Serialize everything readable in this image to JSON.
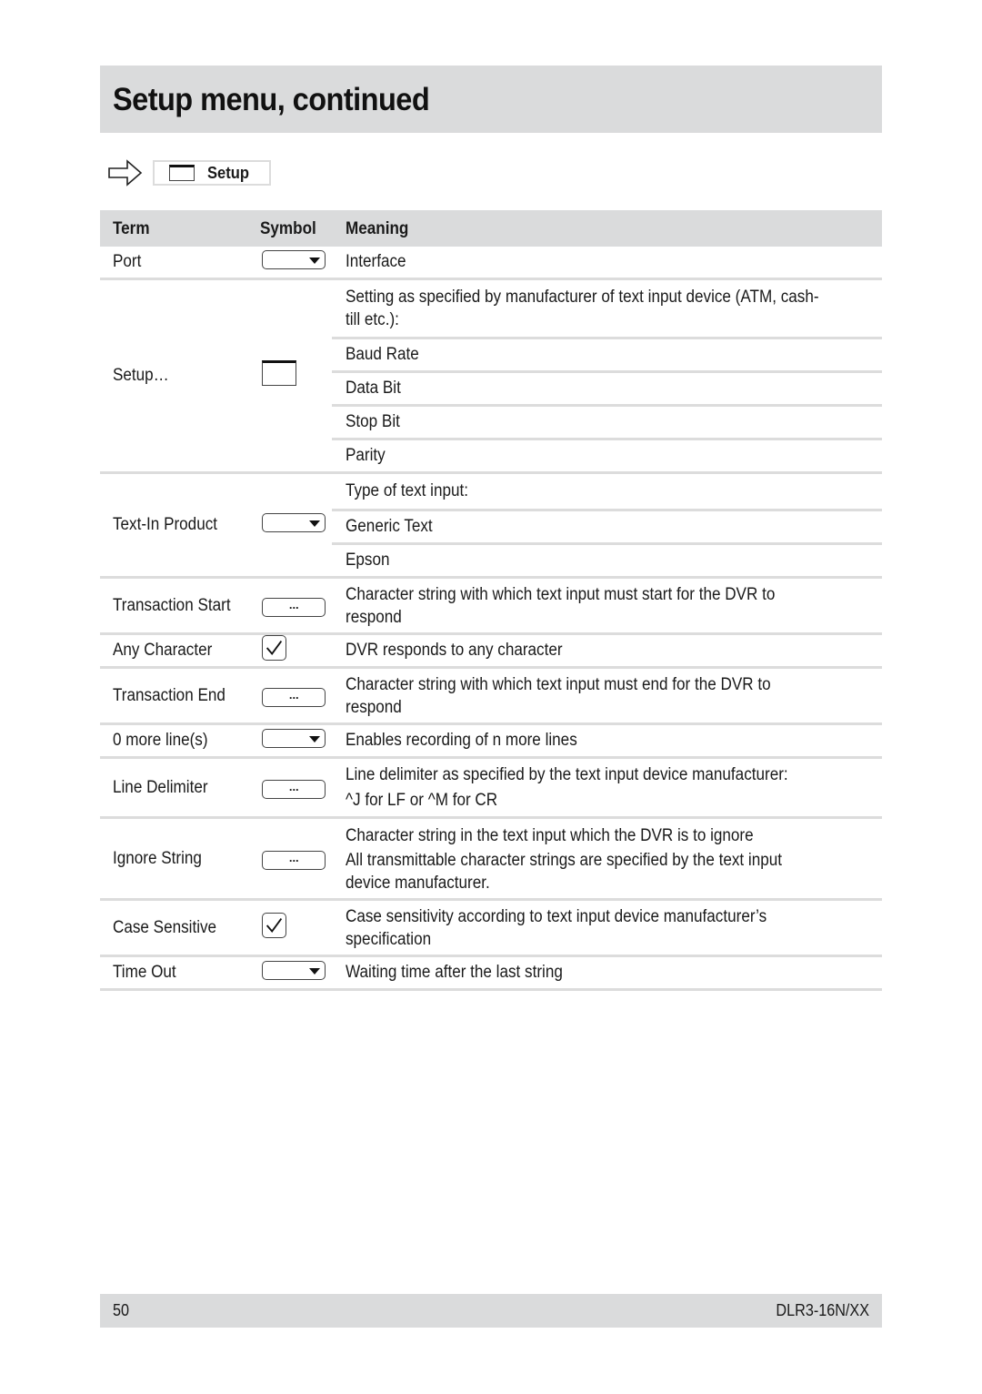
{
  "page": {
    "title": "Setup menu, continued",
    "breadcrumb": {
      "icon": "window-icon",
      "label": "Setup"
    }
  },
  "table": {
    "headers": {
      "term": "Term",
      "symbol": "Symbol",
      "meaning": "Meaning"
    },
    "rows": [
      {
        "term": "Port",
        "symbol": "dropdown",
        "meaning": [
          "Interface"
        ]
      },
      {
        "term": "Setup…",
        "symbol": "window",
        "meaning": [
          "Setting as specified by manufacturer of text input device (ATM, cash-till etc.):",
          "Baud Rate",
          "Data Bit",
          "Stop Bit",
          "Parity"
        ]
      },
      {
        "term": "Text-In Product",
        "symbol": "dropdown",
        "meaning": [
          "Type of text input:",
          "Generic Text",
          "Epson"
        ]
      },
      {
        "term": "Transaction Start",
        "symbol": "ellipsis-button",
        "meaning": [
          "Character string with which text input must start for the DVR to respond"
        ]
      },
      {
        "term": "Any Character",
        "symbol": "checkbox-checked",
        "meaning": [
          "DVR responds to any character"
        ]
      },
      {
        "term": "Transaction End",
        "symbol": "ellipsis-button",
        "meaning": [
          "Character string with which text input must end for the DVR to respond"
        ]
      },
      {
        "term": "0 more line(s)",
        "symbol": "dropdown",
        "meaning": [
          "Enables recording of n more lines"
        ]
      },
      {
        "term": "Line Delimiter",
        "symbol": "ellipsis-button",
        "meaning": [
          "Line delimiter as specified by the text input device manufacturer: ^J for LF or ^M for CR"
        ]
      },
      {
        "term": "Ignore String",
        "symbol": "ellipsis-button",
        "meaning": [
          "Character string in the text input which the DVR is to ignore All transmittable character strings are specified by the text input device manufacturer."
        ]
      },
      {
        "term": "Case Sensitive",
        "symbol": "checkbox-checked",
        "meaning": [
          "Case sensitivity according to text input device manufacturer’s specification"
        ]
      },
      {
        "term": "Time Out",
        "symbol": "dropdown",
        "meaning": [
          "Waiting time after the last string"
        ]
      }
    ],
    "ellipsis": "...",
    "line_delimiter": {
      "line1": "Line delimiter as specified by the text input device manufacturer:",
      "line2": "^J for LF or ^M for CR"
    },
    "ignore_string": {
      "line1": "Character string in the text input which the DVR is to ignore",
      "line2": "All transmittable character strings are specified by the text input device manufacturer."
    }
  },
  "footer": {
    "page_number": "50",
    "model": "DLR3-16N/XX"
  }
}
